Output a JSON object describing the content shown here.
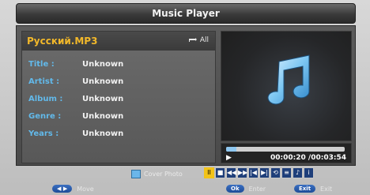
{
  "window": {
    "title": "Music Player"
  },
  "file": {
    "name": "Русский.MP3",
    "repeat_mode": "All"
  },
  "meta": [
    {
      "key": "Title :",
      "value": "Unknown"
    },
    {
      "key": "Artist :",
      "value": "Unknown"
    },
    {
      "key": "Album :",
      "value": "Unknown"
    },
    {
      "key": "Genre :",
      "value": "Unknown"
    },
    {
      "key": "Years :",
      "value": "Unknown"
    }
  ],
  "playback": {
    "state_icon": "play-icon",
    "time": "00:00:20 /00:03:54",
    "progress_fraction": 0.085
  },
  "controls": {
    "cover_mode_label": "Cover Photo",
    "buttons": [
      {
        "name": "pause-button",
        "glyph": "II",
        "active": true
      },
      {
        "name": "stop-button",
        "glyph": "■",
        "active": false
      },
      {
        "name": "rewind-button",
        "glyph": "◀◀",
        "active": false
      },
      {
        "name": "fast-forward-button",
        "glyph": "▶▶",
        "active": false
      },
      {
        "name": "previous-button",
        "glyph": "|◀",
        "active": false
      },
      {
        "name": "next-button",
        "glyph": "▶|",
        "active": false
      },
      {
        "name": "repeat-button",
        "glyph": "⟲",
        "active": false
      },
      {
        "name": "lyrics-button",
        "glyph": "≡",
        "active": false
      },
      {
        "name": "playlist-button",
        "glyph": "♪",
        "active": false
      },
      {
        "name": "info-button",
        "glyph": "i",
        "active": false
      }
    ]
  },
  "hints": [
    {
      "key": "◀ ▶",
      "label": "Move"
    },
    {
      "key": "Ok",
      "label": "Enter"
    },
    {
      "key": "Exit",
      "label": "Exit"
    }
  ],
  "colors": {
    "accent": "#f2b82a",
    "meta_key": "#62b9ea",
    "active_button": "#f2c319"
  }
}
